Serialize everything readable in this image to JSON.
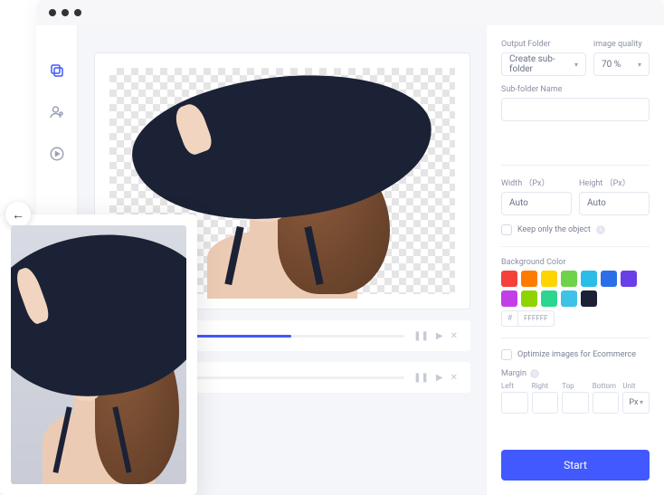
{
  "panel": {
    "outputFolder": {
      "label": "Output Folder",
      "value": "Create sub-folder"
    },
    "imageQuality": {
      "label": "image quality",
      "value": "70 %"
    },
    "subfolder": {
      "label": "Sub-folder Name"
    },
    "width": {
      "label": "Width （Px）",
      "value": "Auto"
    },
    "height": {
      "label": "Height （Px）",
      "value": "Auto"
    },
    "keepOnly": "Keep only the object",
    "bgColor": {
      "label": "Background Color",
      "hex": "FFFFFF",
      "colors": [
        "#f5403c",
        "#ff7a00",
        "#ffd400",
        "#6fd34a",
        "#2bbde8",
        "#2b6fe8",
        "#6a3fe8",
        "#c23fe8",
        "#8fd400",
        "#2bd68f",
        "#3fc2e8",
        "#1b2236"
      ]
    },
    "optimize": "Optimize images for Ecommerce",
    "margin": {
      "label": "Margin",
      "left": "Left",
      "right": "Right",
      "top": "Top",
      "bottom": "Bottom",
      "unit": "Unit",
      "unitValue": "Px"
    },
    "start": "Start"
  },
  "progress": {
    "p1": 62,
    "p2": 0
  }
}
